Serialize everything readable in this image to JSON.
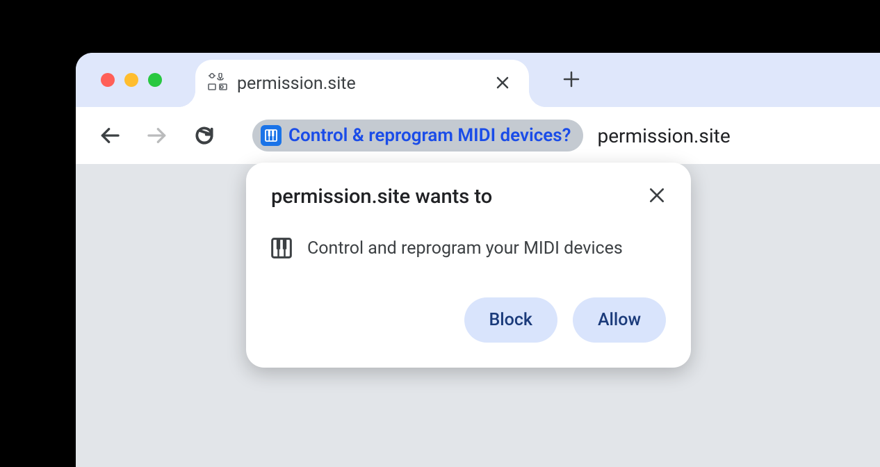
{
  "tab": {
    "title": "permission.site"
  },
  "addressbar": {
    "chip_text": "Control & reprogram MIDI devices?",
    "url": "permission.site"
  },
  "dialog": {
    "title": "permission.site wants to",
    "body_text": "Control and reprogram your MIDI devices",
    "block_label": "Block",
    "allow_label": "Allow"
  }
}
